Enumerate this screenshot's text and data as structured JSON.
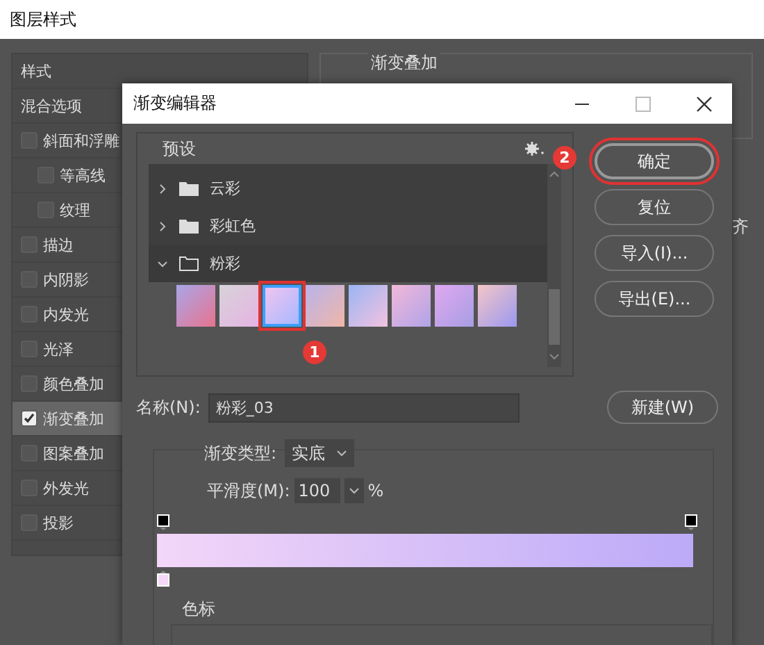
{
  "window": {
    "title": "图层样式"
  },
  "styles_panel": {
    "items": [
      {
        "label": "样式",
        "kind": "header"
      },
      {
        "label": "混合选项",
        "kind": "header"
      },
      {
        "label": "斜面和浮雕",
        "kind": "check",
        "checked": false,
        "children": [
          {
            "label": "等高线",
            "kind": "check",
            "checked": false
          },
          {
            "label": "纹理",
            "kind": "check",
            "checked": false
          }
        ]
      },
      {
        "label": "描边",
        "kind": "check",
        "checked": false
      },
      {
        "label": "内阴影",
        "kind": "check",
        "checked": false
      },
      {
        "label": "内发光",
        "kind": "check",
        "checked": false
      },
      {
        "label": "光泽",
        "kind": "check",
        "checked": false
      },
      {
        "label": "颜色叠加",
        "kind": "check",
        "checked": false
      },
      {
        "label": "渐变叠加",
        "kind": "check",
        "checked": true
      },
      {
        "label": "图案叠加",
        "kind": "check",
        "checked": false
      },
      {
        "label": "外发光",
        "kind": "check",
        "checked": false
      },
      {
        "label": "投影",
        "kind": "check",
        "checked": false
      }
    ]
  },
  "background_section": {
    "title": "渐变叠加",
    "side_label": "齐"
  },
  "dialog": {
    "title": "渐变编辑器",
    "presets": {
      "label": "预设",
      "folders": [
        {
          "name": "云彩",
          "expanded": false
        },
        {
          "name": "彩虹色",
          "expanded": false
        },
        {
          "name": "粉彩",
          "expanded": true
        }
      ],
      "swatches": [
        {
          "selected": false
        },
        {
          "selected": false
        },
        {
          "selected": true
        },
        {
          "selected": false
        },
        {
          "selected": false
        },
        {
          "selected": false
        },
        {
          "selected": false
        },
        {
          "selected": false
        }
      ]
    },
    "buttons": [
      "确定",
      "复位",
      "导入(I)...",
      "导出(E)..."
    ],
    "name_label": "名称(N):",
    "name_value": "粉彩_03",
    "new_button": "新建(W)",
    "type_label": "渐变类型:",
    "type_value": "实底",
    "smooth_label": "平滑度(M):",
    "smooth_value": "100",
    "smooth_unit": "%",
    "stops_label": "色标"
  },
  "annotations": [
    {
      "label": "1"
    },
    {
      "label": "2"
    }
  ]
}
